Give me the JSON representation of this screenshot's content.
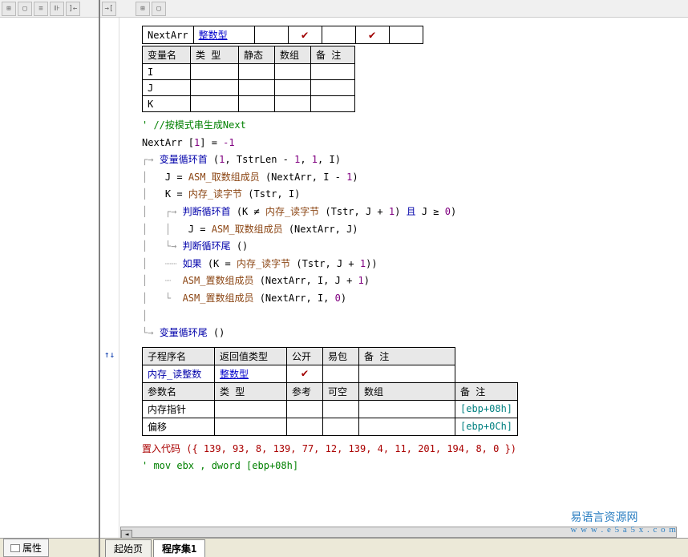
{
  "toolbar": {
    "icons": [
      "⊞",
      "▢",
      "≡",
      "⊪",
      "]←",
      "→[",
      "",
      "⊞",
      "▢",
      ""
    ]
  },
  "top_row": {
    "name": "NextArr",
    "type": "整数型"
  },
  "var_table": {
    "headers": [
      "变量名",
      "类 型",
      "静态",
      "数组",
      "备 注"
    ],
    "rows": [
      [
        "I",
        "",
        "",
        "",
        ""
      ],
      [
        "J",
        "",
        "",
        "",
        ""
      ],
      [
        "K",
        "",
        "",
        "",
        ""
      ]
    ]
  },
  "code": {
    "c1": "' //按模式串生成Next",
    "c2_a": "NextArr",
    "c2_b": " [",
    "c2_c": "1",
    "c2_d": "] = ",
    "c2_e": "-1",
    "c3_fn": "变量循环首",
    "c3_args_a": " (",
    "c3_args_b": "1",
    "c3_args_c": ", TstrLen - ",
    "c3_args_d": "1",
    "c3_args_e": ", ",
    "c3_args_f": "1",
    "c3_args_g": ", I)",
    "c4_a": "J = ",
    "c4_fn": "ASM_取数组成员",
    "c4_b": " (NextArr, I - ",
    "c4_c": "1",
    "c4_d": ")",
    "c5_a": "K = ",
    "c5_fn": "内存_读字节",
    "c5_b": " (Tstr, I)",
    "c6_fn": "判断循环首",
    "c6_a": " (K ≠ ",
    "c6_fn2": "内存_读字节",
    "c6_b": " (Tstr, J + ",
    "c6_c": "1",
    "c6_d": ") ",
    "c6_e": "且",
    "c6_f": " J ≥ ",
    "c6_g": "0",
    "c6_h": ")",
    "c7_a": "J = ",
    "c7_fn": "ASM_取数组成员",
    "c7_b": " (NextArr, J)",
    "c8_fn": "判断循环尾",
    "c8_a": " ()",
    "c9_fn": "如果",
    "c9_a": " (K = ",
    "c9_fn2": "内存_读字节",
    "c9_b": " (Tstr, J + ",
    "c9_c": "1",
    "c9_d": "))",
    "c10_fn": "ASM_置数组成员",
    "c10_a": " (NextArr, I, J + ",
    "c10_b": "1",
    "c10_c": ")",
    "c11_fn": "ASM_置数组成员",
    "c11_a": " (NextArr, I, ",
    "c11_b": "0",
    "c11_c": ")",
    "c12_fn": "变量循环尾",
    "c12_a": " ()"
  },
  "sub_table": {
    "h1": [
      "子程序名",
      "返回值类型",
      "公开",
      "易包",
      "备 注"
    ],
    "r1_name": "内存_读整数",
    "r1_type": "整数型",
    "h2": [
      "参数名",
      "类 型",
      "参考",
      "可空",
      "数组",
      "备 注"
    ],
    "r2": [
      "内存指针",
      "",
      "",
      "",
      "",
      "[ebp+08h]"
    ],
    "r3": [
      "偏移",
      "",
      "",
      "",
      "",
      "[ebp+0Ch]"
    ]
  },
  "asm1": "置入代码 ({ 139, 93, 8, 139, 77, 12, 139, 4, 11, 201, 194, 8, 0 })",
  "asm2": "' mov ebx , dword [ebp+08h]",
  "left_prop": "属性",
  "tabs": {
    "t1": "起始页",
    "t2": "程序集1"
  },
  "watermark": {
    "text": "易语言资源网",
    "url": "w w w . e 5 a 5 x . c o m"
  }
}
